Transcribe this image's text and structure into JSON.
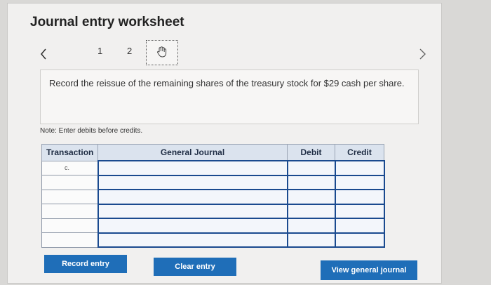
{
  "header": {
    "title": "Journal entry worksheet"
  },
  "nav": {
    "page1": "1",
    "page2": "2",
    "current_icon": "hand-pointer-icon"
  },
  "instruction": {
    "text": "Record the reissue of the remaining shares of the treasury stock for $29 cash per share."
  },
  "note": {
    "text": "Note: Enter debits before credits."
  },
  "table": {
    "headers": {
      "transaction": "Transaction",
      "general_journal": "General Journal",
      "debit": "Debit",
      "credit": "Credit"
    },
    "rows": [
      {
        "transaction": "c.",
        "account": "",
        "debit": "",
        "credit": ""
      },
      {
        "transaction": "",
        "account": "",
        "debit": "",
        "credit": ""
      },
      {
        "transaction": "",
        "account": "",
        "debit": "",
        "credit": ""
      },
      {
        "transaction": "",
        "account": "",
        "debit": "",
        "credit": ""
      },
      {
        "transaction": "",
        "account": "",
        "debit": "",
        "credit": ""
      },
      {
        "transaction": "",
        "account": "",
        "debit": "",
        "credit": ""
      }
    ]
  },
  "buttons": {
    "record": "Record entry",
    "clear": "Clear entry",
    "view": "View general journal"
  }
}
